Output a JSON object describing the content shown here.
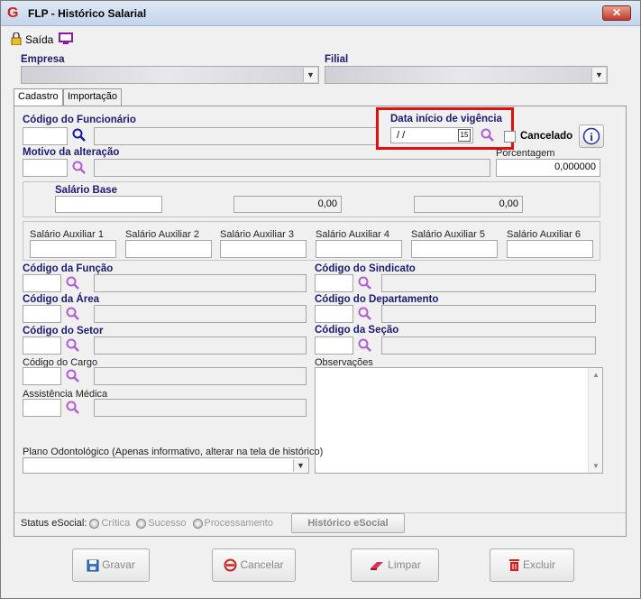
{
  "window": {
    "title": "FLP - Histórico Salarial",
    "close_label": "✕"
  },
  "toolbar": {
    "exit_label": "Saída"
  },
  "header": {
    "empresa_label": "Empresa",
    "filial_label": "Filial"
  },
  "tabs": [
    {
      "label": "Cadastro"
    },
    {
      "label": "Importação"
    }
  ],
  "form": {
    "codigo_funcionario": "Código do Funcionário",
    "data_inicio": "Data início de vigência",
    "date_value": "/ /",
    "date_btn": "15",
    "cancelado": "Cancelado",
    "motivo": "Motivo da alteração",
    "porcentagem": "Porcentagem",
    "porcentagem_value": "0,000000",
    "salario_base": "Salário Base",
    "sal_value1": "0,00",
    "sal_value2": "0,00",
    "aux_labels": [
      "Salário Auxiliar 1",
      "Salário Auxiliar 2",
      "Salário Auxiliar 3",
      "Salário Auxiliar 4",
      "Salário Auxiliar 5",
      "Salário Auxiliar 6"
    ],
    "codigo_funcao": "Código da Função",
    "codigo_sindicato": "Código do Sindicato",
    "codigo_area": "Código da Área",
    "codigo_departamento": "Código do Departamento",
    "codigo_setor": "Código do Setor",
    "codigo_secao": "Código da Seção",
    "codigo_cargo": "Código do Cargo",
    "observacoes": "Observações",
    "assistencia": "Assistência Médica",
    "plano_odonto": "Plano Odontológico (Apenas informativo, alterar na tela de histórico)"
  },
  "status": {
    "label": "Status eSocial:",
    "options": [
      "Crítica",
      "Sucesso",
      "Processamento"
    ],
    "historico_btn": "Histórico eSocial"
  },
  "buttons": {
    "gravar": "Gravar",
    "cancelar": "Cancelar",
    "limpar": "Limpar",
    "excluir": "Excluir"
  }
}
